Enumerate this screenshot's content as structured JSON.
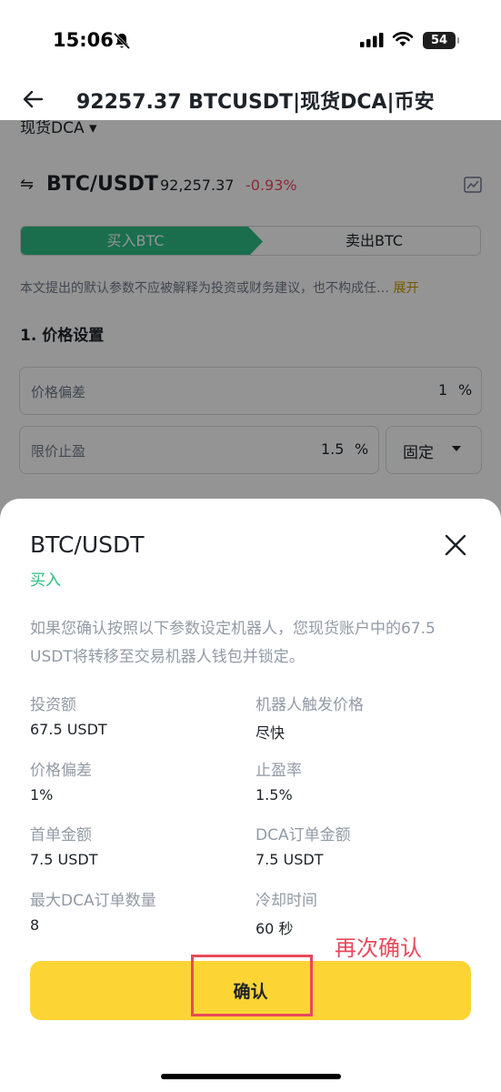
{
  "status_bar": {
    "time": "15:06",
    "battery": "54"
  },
  "header": {
    "title": "92257.37 BTCUSDT|现货DCA|币安"
  },
  "page": {
    "strategy_type": "现货DCA ▾",
    "pair": "BTC/USDT",
    "price": "92,257.37",
    "change": "-0.93%",
    "tab_buy": "买入BTC",
    "tab_sell": "卖出BTC",
    "disclaimer": "本文提出的默认参数不应被解释为投资或财务建议，也不构成任…",
    "expand": "展开",
    "section_title": "1. 价格设置",
    "price_deviation_label": "价格偏差",
    "price_deviation_value": "1",
    "pct_unit": "%",
    "take_profit_label": "限价止盈",
    "take_profit_value": "1.5",
    "mode_select": "固定"
  },
  "sheet": {
    "title": "BTC/USDT",
    "side": "买入",
    "notice": "如果您确认按照以下参数设定机器人，您现货账户中的67.5 USDT将转移至交易机器人钱包并锁定。",
    "items": [
      {
        "label": "投资额",
        "value": "67.5 USDT"
      },
      {
        "label": "机器人触发价格",
        "value": "尽快"
      },
      {
        "label": "价格偏差",
        "value": "1%"
      },
      {
        "label": "止盈率",
        "value": "1.5%"
      },
      {
        "label": "首单金额",
        "value": "7.5 USDT"
      },
      {
        "label": "DCA订单金额",
        "value": "7.5 USDT"
      },
      {
        "label": "最大DCA订单数量",
        "value": "8"
      },
      {
        "label": "冷却时间",
        "value": "60 秒"
      }
    ],
    "confirm": "确认",
    "annotation": "再次确认"
  }
}
